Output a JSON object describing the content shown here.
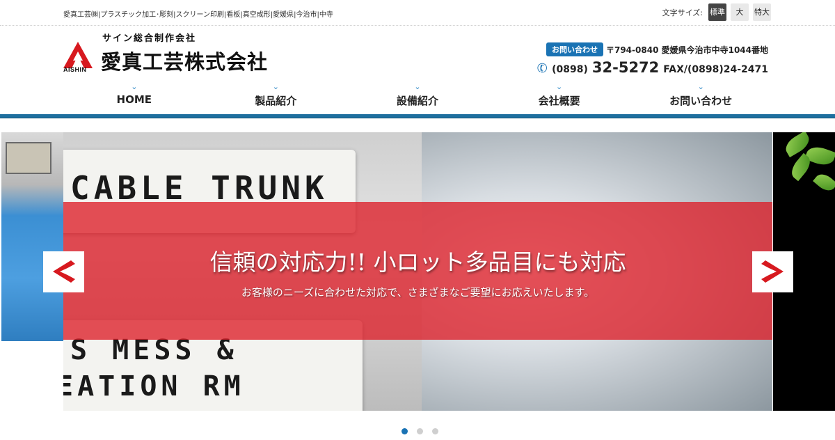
{
  "topbar": {
    "description": "愛真工芸㈱|プラスチック加工･彫刻|スクリーン印刷|看板|真空成形|愛媛県|今治市|中寺",
    "font_size_label": "文字サイズ:",
    "font_size_options": [
      "標準",
      "大",
      "特大"
    ],
    "font_size_selected": "標準"
  },
  "logo": {
    "tagline": "サイン総合制作会社",
    "company_name": "愛真工芸株式会社",
    "mark_text": "AISHIN"
  },
  "contact": {
    "badge": "お問い合わせ",
    "address": "〒794-0840 愛媛県今治市中寺1044番地",
    "tel_prefix": "(0898)",
    "tel_main": "32-5272",
    "fax": "FAX/(0898)24-2471"
  },
  "nav": {
    "items": [
      {
        "label": "HOME"
      },
      {
        "label": "製品紹介"
      },
      {
        "label": "設備紹介"
      },
      {
        "label": "会社概要"
      },
      {
        "label": "お問い合わせ"
      }
    ]
  },
  "slider": {
    "title": "信頼の対応力!! 小ロット多品目にも対応",
    "subtitle": "お客様のニーズに合わせた対応で、さまざまなご要望にお応えいたします。",
    "sign_texts": [
      "CABLE TRUNK",
      "S MESS &",
      "EATION RM"
    ],
    "slide_count": 3,
    "active_index": 0
  },
  "colors": {
    "accent_blue": "#1a73b4",
    "nav_bar": "#1e6f9f",
    "banner_red": "#dc1e28"
  }
}
